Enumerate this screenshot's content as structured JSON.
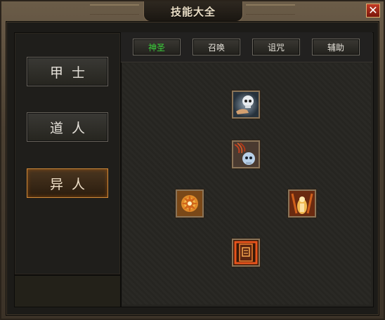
{
  "window": {
    "title": "技能大全",
    "close_icon": "✕"
  },
  "classes": [
    {
      "label": "甲士",
      "active": false
    },
    {
      "label": "道人",
      "active": false
    },
    {
      "label": "异人",
      "active": true
    }
  ],
  "tabs": [
    {
      "label": "神圣",
      "active": true
    },
    {
      "label": "召唤",
      "active": false
    },
    {
      "label": "诅咒",
      "active": false
    },
    {
      "label": "辅助",
      "active": false
    }
  ],
  "skills": [
    {
      "icon": "skull-hand-icon"
    },
    {
      "icon": "skull-claw-icon"
    },
    {
      "icon": "fire-rune-icon"
    },
    {
      "icon": "light-aura-icon"
    },
    {
      "icon": "flame-tome-icon"
    }
  ],
  "colors": {
    "active_tab_text": "#3ad13a",
    "active_class_border": "#d08a3a",
    "close_button": "#c23a24"
  }
}
